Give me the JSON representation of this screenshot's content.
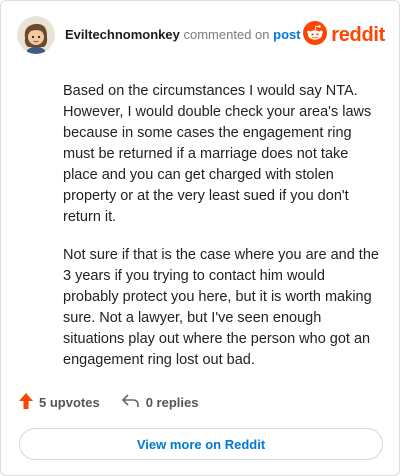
{
  "header": {
    "author": "Eviltechnomonkey",
    "action": "commented on",
    "post_link": "post",
    "brand": "reddit"
  },
  "comment": {
    "paragraphs": [
      "Based on the circumstances I would say NTA. However, I would double check your area's laws because in some cases the engagement ring must be returned if a marriage does not take place and you can get charged with stolen property or at the very least sued if you don't return it.",
      "Not sure if that is the case where you are and the 3 years if you trying to contact him would probably protect you here, but it is worth making sure. Not a lawyer, but I've seen enough situations play out where the person who got an engagement ring lost out bad."
    ]
  },
  "footer": {
    "upvotes": "5 upvotes",
    "replies": "0 replies",
    "view_more": "View more on Reddit"
  },
  "icons": {
    "upvote": "upvote-arrow-icon",
    "reply": "reply-arrow-icon",
    "brand": "reddit-snoo-icon"
  },
  "colors": {
    "accent": "#ff4500",
    "link": "#0079d3"
  }
}
